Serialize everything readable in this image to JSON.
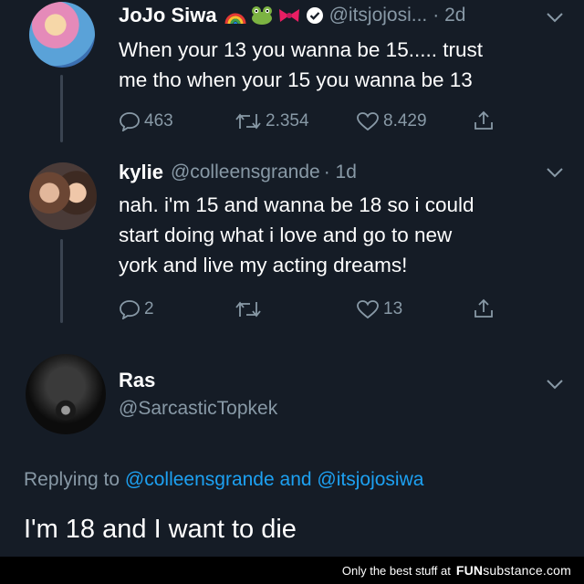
{
  "tweet1": {
    "name": "JoJo Siwa",
    "emoji": [
      "rainbow-emoji",
      "frog-emoji",
      "bow-emoji",
      "verified-badge"
    ],
    "handle": "@itsjojosi...",
    "time": "· 2d",
    "text_line1": "When your 13 you wanna be 15..... trust",
    "text_line2": "me tho when your 15 you wanna be 13",
    "replies": "463",
    "retweets": "2.354",
    "likes": "8.429"
  },
  "tweet2": {
    "name": "kylie",
    "handle": "@colleensgrande",
    "time": "· 1d",
    "text_line1": "nah. i'm 15 and wanna be 18 so i could",
    "text_line2": "start doing what i love and go to new",
    "text_line3": "york and live my acting dreams!",
    "replies": "2",
    "likes": "13"
  },
  "tweet3": {
    "name": "Ras",
    "handle": "@SarcasticTopkek",
    "replying_prefix": "Replying to",
    "replying_user1": "@colleensgrande",
    "replying_and": "and",
    "replying_user2": "@itsjojosiwa",
    "text": "I'm 18 and I want to die"
  },
  "footer": {
    "tagline": "Only the best stuff at",
    "brand_bold": "FUN",
    "brand_rest": "substance",
    "brand_tld": ".com"
  },
  "colors": {
    "background": "#151c26",
    "secondary_text": "#8899a6",
    "link": "#1da1f2"
  }
}
